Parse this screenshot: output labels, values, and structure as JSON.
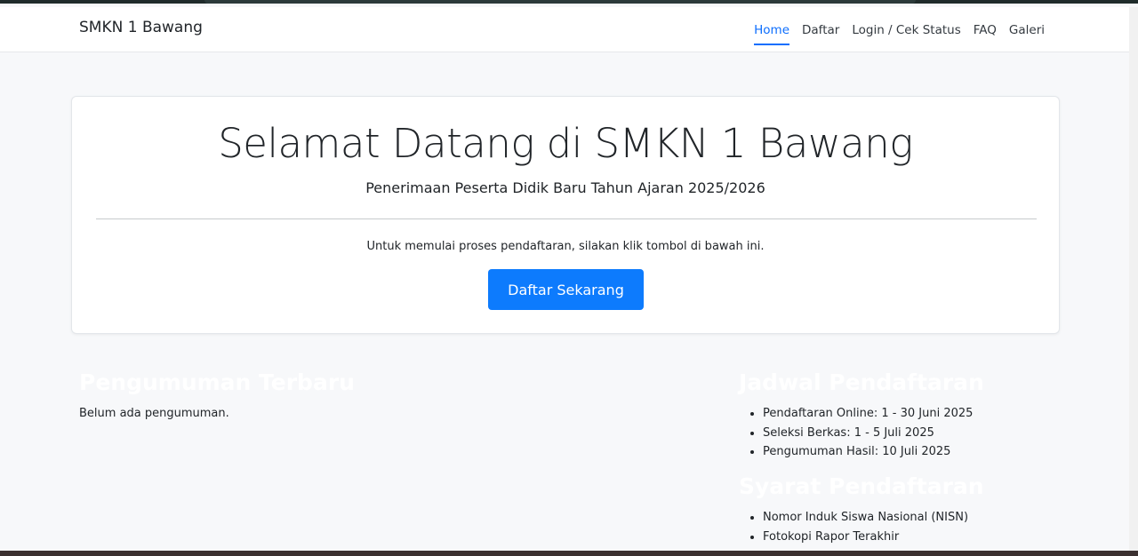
{
  "navbar": {
    "brand": "SMKN 1 Bawang",
    "links": [
      {
        "label": "Home",
        "active": true
      },
      {
        "label": "Daftar",
        "active": false
      },
      {
        "label": "Login / Cek Status",
        "active": false
      },
      {
        "label": "FAQ",
        "active": false
      },
      {
        "label": "Galeri",
        "active": false
      }
    ]
  },
  "hero": {
    "title": "Selamat Datang di SMKN 1 Bawang",
    "subtitle": "Penerimaan Peserta Didik Baru Tahun Ajaran 2025/2026",
    "text": "Untuk memulai proses pendaftaran, silakan klik tombol di bawah ini.",
    "cta_label": "Daftar Sekarang"
  },
  "announcements": {
    "heading": "Pengumuman Terbaru",
    "empty_text": "Belum ada pengumuman."
  },
  "schedule": {
    "heading": "Jadwal Pendaftaran",
    "items": [
      "Pendaftaran Online: 1 - 30 Juni 2025",
      "Seleksi Berkas: 1 - 5 Juli 2025",
      "Pengumuman Hasil: 10 Juli 2025"
    ]
  },
  "requirements": {
    "heading": "Syarat Pendaftaran",
    "items": [
      "Nomor Induk Siswa Nasional (NISN)",
      "Fotokopi Rapor Terakhir"
    ]
  },
  "colors": {
    "accent": "#0d6efd",
    "button": "#0d7bfd",
    "background": "#f7f8fa"
  }
}
